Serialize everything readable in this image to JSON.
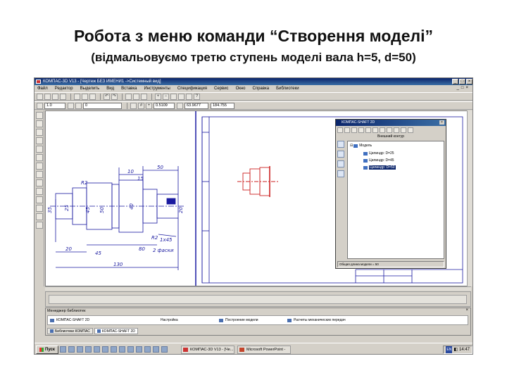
{
  "slide": {
    "title": "Робота з меню команди “Створення моделі”",
    "subtitle": "(відмальовуємо третю ступень моделі вала h=5, d=50)"
  },
  "app": {
    "window_title": "КОМПАС-3D V13 - [Чертеж БЕЗ ИМЕНИ1 ->Системный вид]",
    "menu": [
      "Файл",
      "Редактор",
      "Выделить",
      "Вид",
      "Вставка",
      "Инструменты",
      "Спецификация",
      "Сервис",
      "Окно",
      "Справка",
      "Библиотеки"
    ],
    "toolbar2": {
      "scale": "1.0",
      "layer": "0",
      "x_coord": "63.9677",
      "y_coord": "184.755",
      "step": "0.5109"
    },
    "colors": {
      "accent": "#0a246a",
      "model_line": "#cc2222",
      "drawing_line": "#1a1aa0"
    }
  },
  "drawing": {
    "dims": [
      "R2",
      "35",
      "25",
      "45",
      "50",
      "40",
      "R2",
      "20",
      "15",
      "50",
      "10",
      "2 фаски",
      "1x45",
      "20",
      "45",
      "80",
      "130"
    ]
  },
  "shaft_window": {
    "title": "КОМПАС-SHAFT 2D",
    "section": "Внешний контур",
    "tree": {
      "root": "Модель",
      "items": [
        {
          "label": "Цилиндр: D=25",
          "selected": false
        },
        {
          "label": "Цилиндр: D=45",
          "selected": false
        },
        {
          "label": "Цилиндр: D=50",
          "selected": true
        }
      ]
    },
    "status": "Общая длина модели = 50"
  },
  "library_manager": {
    "title": "Менеджер библиотек",
    "row": [
      "КОМПАС-SHAFT 2D",
      "Настройка",
      "Построение модели",
      "Расчеты механических передач"
    ],
    "tabs": [
      "Библиотеки КОМПАС",
      "КОМПАС-SHAFT 2D"
    ]
  },
  "taskbar": {
    "start": "Пуск",
    "tasks": [
      "КОМПАС-3D V13 - [Че...",
      "Microsoft PowerPoint - [..."
    ],
    "lang": "EN",
    "clock": "14:47"
  }
}
